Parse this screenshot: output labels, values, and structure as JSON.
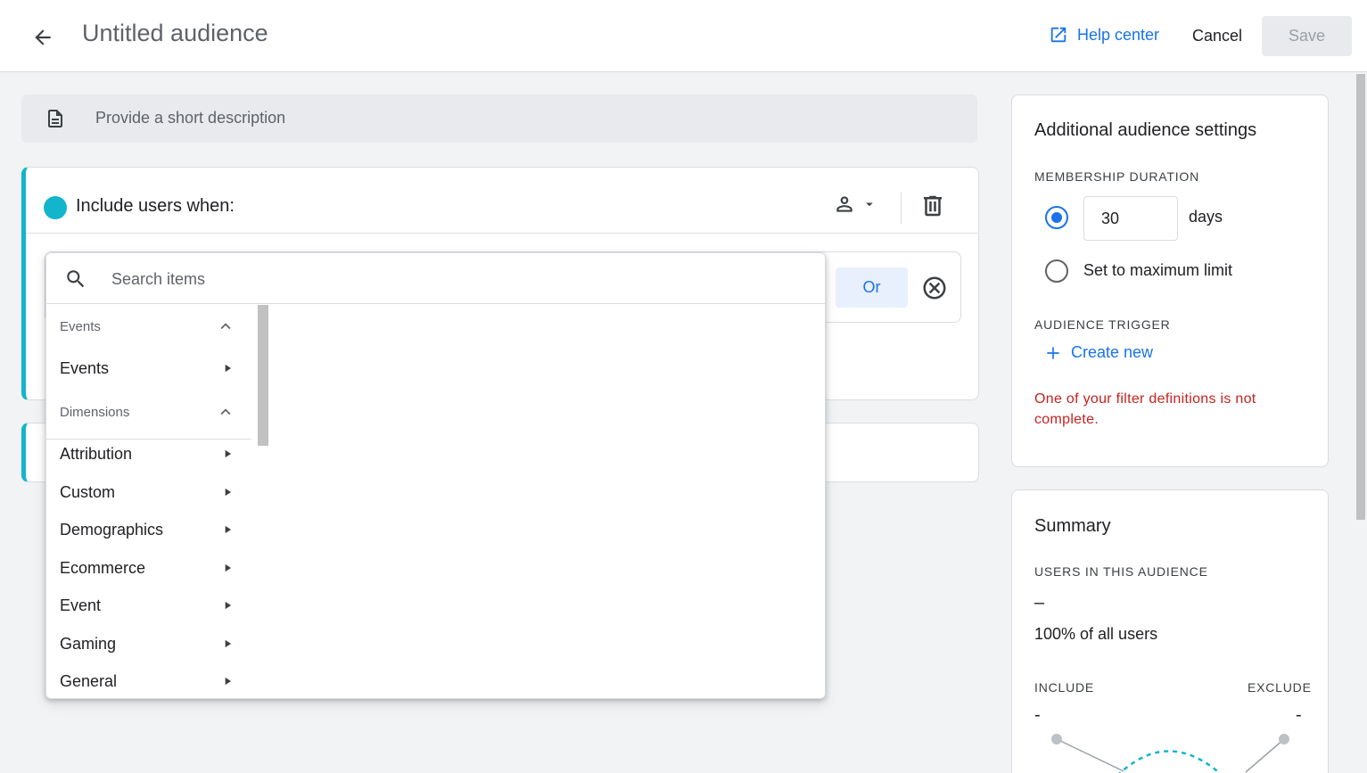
{
  "header": {
    "title": "Untitled audience",
    "help_label": "Help center",
    "cancel_label": "Cancel",
    "save_label": "Save"
  },
  "description": {
    "placeholder": "Provide a short description"
  },
  "include_card": {
    "title": "Include users when:",
    "or_label": "Or",
    "accent_color": "#12b5cb"
  },
  "dropdown": {
    "search_placeholder": "Search items",
    "sections": [
      {
        "label": "Events",
        "items": [
          "Events"
        ]
      },
      {
        "label": "Dimensions",
        "items": [
          "Attribution",
          "Custom",
          "Demographics",
          "Ecommerce",
          "Event",
          "Gaming",
          "General"
        ]
      }
    ]
  },
  "settings": {
    "title": "Additional audience settings",
    "membership_label": "MEMBERSHIP DURATION",
    "days_value": "30",
    "days_unit": "days",
    "max_label": "Set to maximum limit",
    "trigger_label": "AUDIENCE TRIGGER",
    "create_label": "Create new",
    "error_text": "One of your filter definitions is not complete.",
    "error_color": "#c5221f"
  },
  "summary": {
    "title": "Summary",
    "users_label": "USERS IN THIS AUDIENCE",
    "users_value": "–",
    "users_pct": "100% of all users",
    "include_label": "INCLUDE",
    "exclude_label": "EXCLUDE",
    "include_value": "-",
    "exclude_value": "-"
  },
  "colors": {
    "link": "#1a73e8",
    "accent": "#12b5cb"
  }
}
